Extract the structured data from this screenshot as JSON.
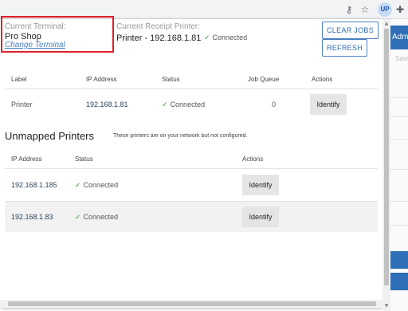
{
  "browser": {
    "icons": [
      "key-icon",
      "star-icon",
      "puzzle-icon"
    ],
    "avatar_initials": "UP"
  },
  "background_page": {
    "admin_label": "Admin",
    "save_label": "Save"
  },
  "terminal": {
    "label": "Current Terminal:",
    "name": "Pro Shop",
    "change_link": "Change Terminal"
  },
  "receipt_printer": {
    "label": "Current Receipt Printer:",
    "value": "Printer - 192.168.1.81",
    "status": "Connected"
  },
  "buttons": {
    "clear_jobs": "CLEAR JOBS",
    "refresh": "REFRESH"
  },
  "mapped_table": {
    "headers": {
      "label": "Label",
      "ip": "IP Address",
      "status": "Status",
      "queue": "Job Queue",
      "actions": "Actions"
    },
    "rows": [
      {
        "label": "Printer",
        "ip": "192.168.1.81",
        "status": "Connected",
        "queue": "0",
        "action": "Identify"
      }
    ]
  },
  "unmapped": {
    "title": "Unmapped Printers",
    "note": "These printers are on your network but not configured.",
    "headers": {
      "ip": "IP Address",
      "status": "Status",
      "actions": "Actions"
    },
    "rows": [
      {
        "ip": "192.168.1.185",
        "status": "Connected",
        "action": "Identify"
      },
      {
        "ip": "192.168.1.83",
        "status": "Connected",
        "action": "Identify"
      }
    ]
  },
  "colors": {
    "highlight_border": "#e0202a",
    "link": "#4a7fc1",
    "check": "#3a9b3a",
    "brand_blue": "#2f6fb7"
  }
}
